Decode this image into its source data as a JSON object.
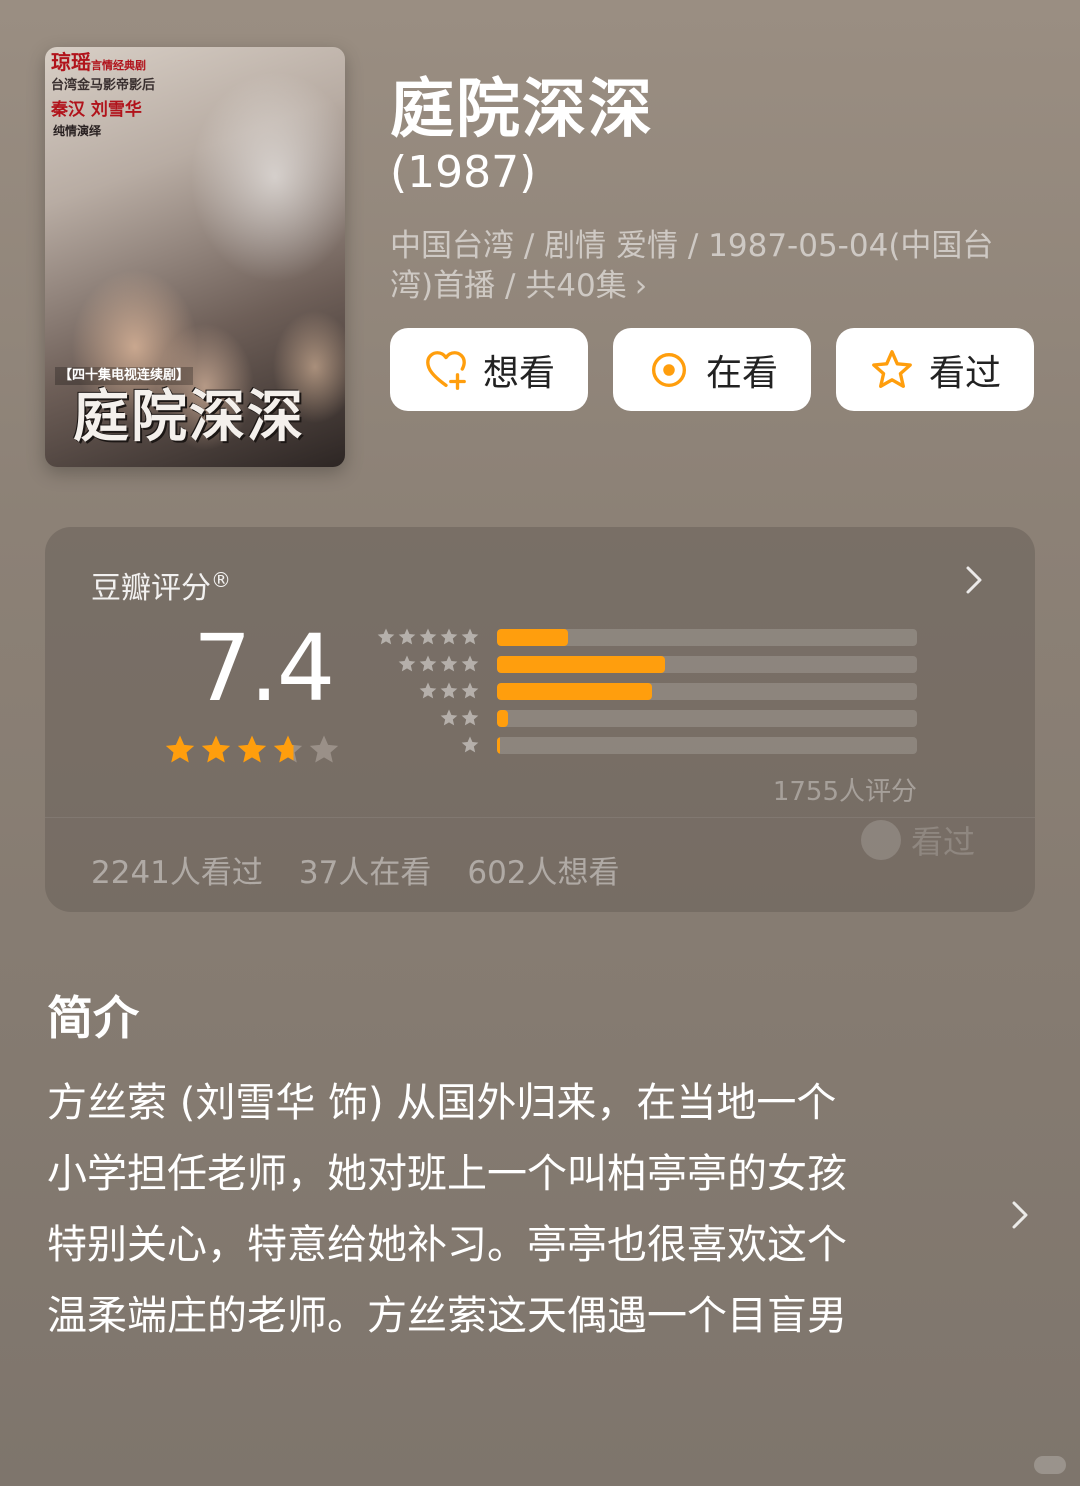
{
  "poster": {
    "brand": "琼瑶",
    "brand_sub": "言情经典剧",
    "award": "台湾金马影帝影后",
    "cast": "秦汉 刘雪华",
    "tagline": "纯情演绎",
    "series": "【四十集电视连续剧】",
    "title": "庭院深深"
  },
  "show": {
    "title": "庭院深深",
    "year": "(1987)",
    "meta_line1": "中国台湾 / 剧情 爱情 / 1987-05-04(中国台",
    "meta_line2": "湾)首播 / 共40集",
    "meta_chevron": "›"
  },
  "actions": {
    "want": "想看",
    "watching": "在看",
    "watched": "看过"
  },
  "rating": {
    "label": "豆瓣评分",
    "reg": "®",
    "score": "7.4",
    "star_value": 3.7,
    "distribution": [
      {
        "stars": 5,
        "fraction": 0.17
      },
      {
        "stars": 4,
        "fraction": 0.4
      },
      {
        "stars": 3,
        "fraction": 0.37
      },
      {
        "stars": 2,
        "fraction": 0.025
      },
      {
        "stars": 1,
        "fraction": 0.005
      }
    ],
    "raters": "1755人评分",
    "float_label": "看过",
    "counts": [
      "2241人看过",
      "37人在看",
      "602人想看"
    ]
  },
  "synopsis": {
    "heading": "简介",
    "lines": [
      "方丝萦 (刘雪华 饰) 从国外归来，在当地一个",
      "小学担任老师，她对班上一个叫柏亭亭的女孩",
      "特别关心，特意给她补习。亭亭也很喜欢这个",
      "温柔端庄的老师。方丝萦这天偶遇一个目盲男"
    ]
  },
  "colors": {
    "accent": "#ff9e0d",
    "star_empty": "#9a9088",
    "bar_track": "rgba(255,255,255,0.16)"
  }
}
